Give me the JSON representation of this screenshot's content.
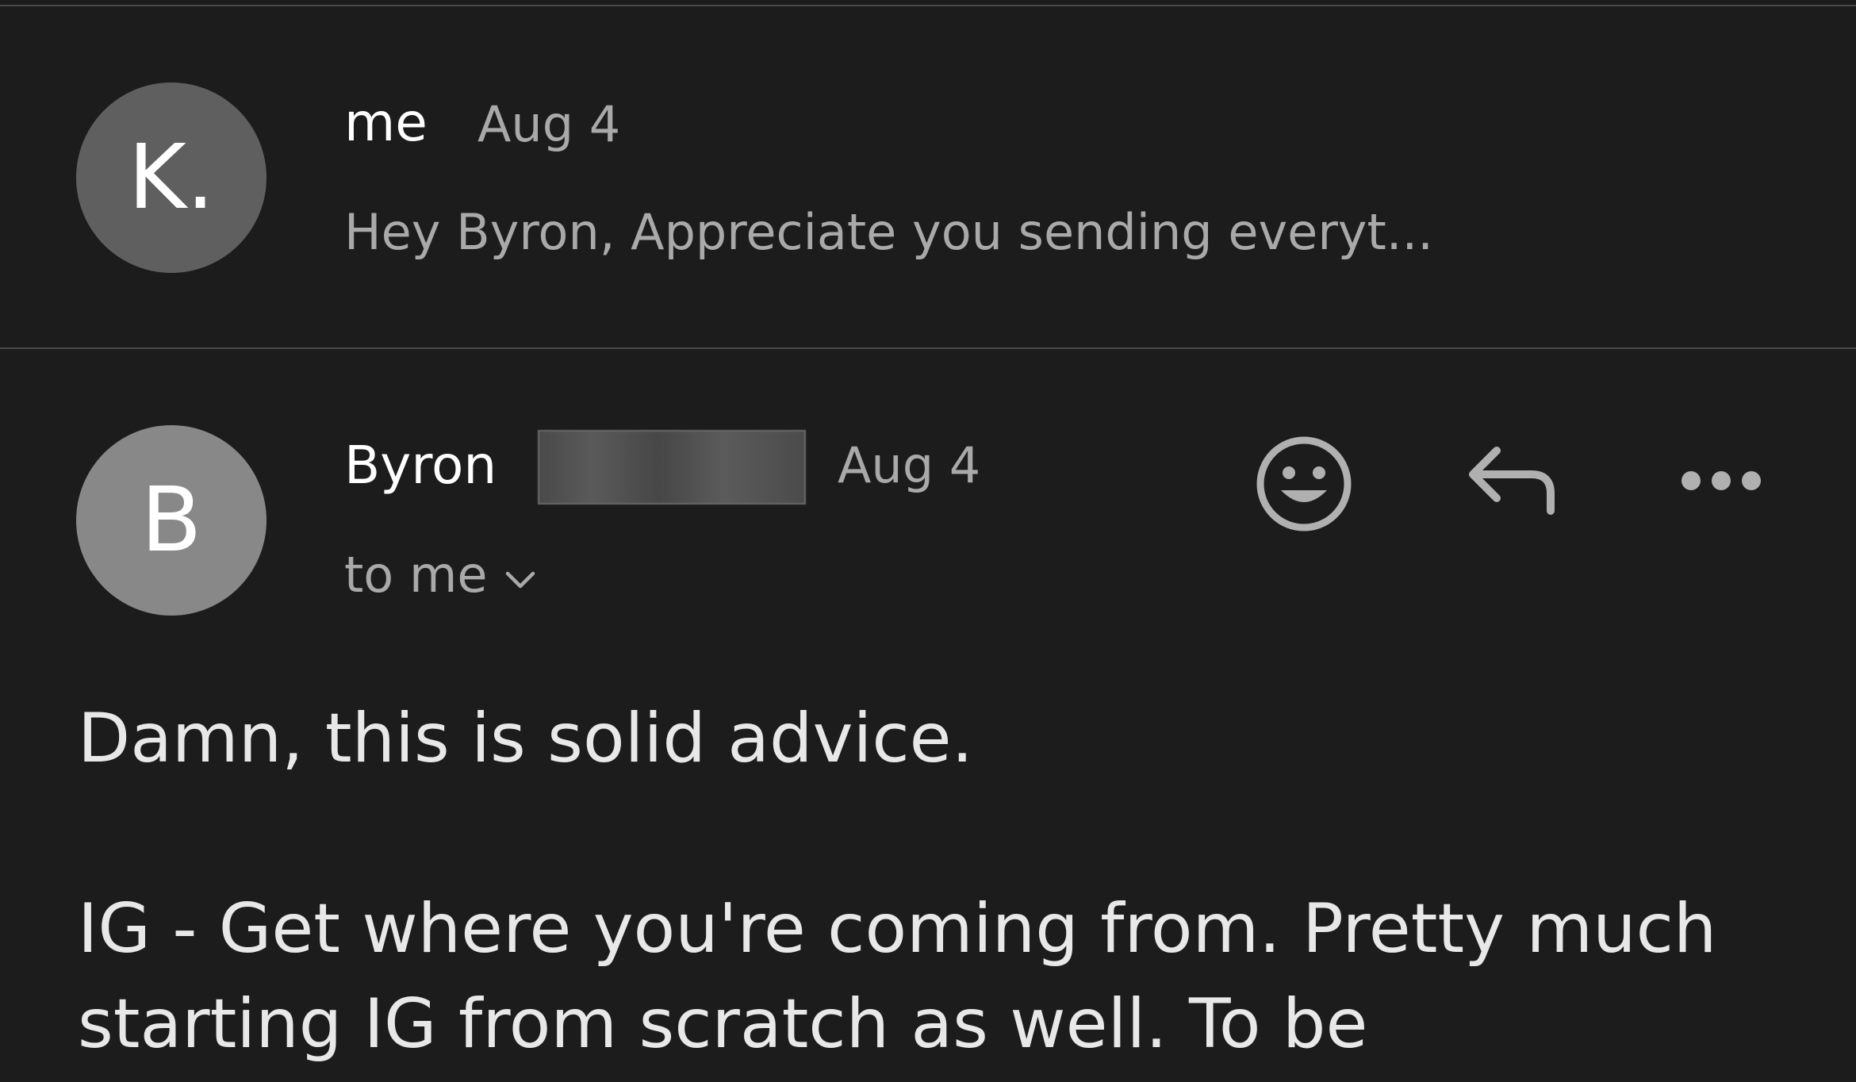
{
  "thread": [
    {
      "avatar_initial": "K.",
      "sender": "me",
      "date": "Aug 4",
      "snippet": "Hey Byron, Appreciate you sending everyt..."
    },
    {
      "avatar_initial": "B",
      "sender": "Byron",
      "date": "Aug 4",
      "recipient_label": "to me",
      "body": [
        "Damn, this is solid advice.",
        "IG - Get where you're coming from. Pretty much",
        "starting IG from scratch as well. To be"
      ]
    }
  ],
  "icons": {
    "emoji": "smiley-face-icon",
    "reply": "reply-icon",
    "more": "more-horizontal-icon",
    "expand": "chevron-down-icon"
  },
  "colors": {
    "background": "#1c1c1c",
    "divider": "#4a4a4a",
    "avatar_k": "#5f5f5f",
    "avatar_b": "#888888",
    "primary_text": "#ffffff",
    "secondary_text": "#a9a9a9",
    "icon": "#b0b0b0"
  }
}
